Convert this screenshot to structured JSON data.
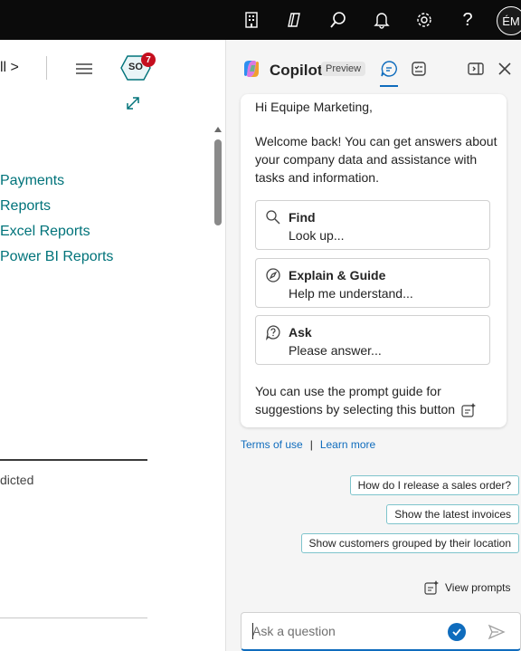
{
  "topbar": {
    "icons": [
      "building-icon",
      "environment-icon",
      "search-icon",
      "bell-icon",
      "gear-icon",
      "help-icon"
    ],
    "help_label": "?",
    "avatar_initials": "ÉM"
  },
  "left": {
    "crumb_label": "ll >",
    "so_badge": "SO",
    "so_count": "7",
    "links": [
      "Payments",
      "Reports",
      "Excel Reports",
      "Power BI Reports"
    ],
    "partial_label": "dicted"
  },
  "copilot": {
    "title": "Copilot",
    "preview_badge": "Preview",
    "greeting": "Hi Equipe Marketing,",
    "welcome": "Welcome back! You can get answers about your company data and assistance with tasks and information.",
    "options": [
      {
        "title": "Find",
        "subtitle": "Look up..."
      },
      {
        "title": "Explain & Guide",
        "subtitle": "Help me understand..."
      },
      {
        "title": "Ask",
        "subtitle": "Please answer..."
      }
    ],
    "prompt_guide_text": "You can use the prompt guide for suggestions by selecting this button",
    "terms_label": "Terms of use",
    "separator": "|",
    "learn_more_label": "Learn more",
    "suggestions": [
      "How do I release a sales order?",
      "Show the latest invoices",
      "Show customers grouped by their location"
    ],
    "view_prompts_label": "View prompts",
    "input_placeholder": "Ask a question"
  },
  "colors": {
    "topbar_bg": "#0b0b0b",
    "link": "#00737a",
    "accent": "#0f6cbd",
    "badge_red": "#c50f1f",
    "chip_border": "#7ec4cc"
  }
}
